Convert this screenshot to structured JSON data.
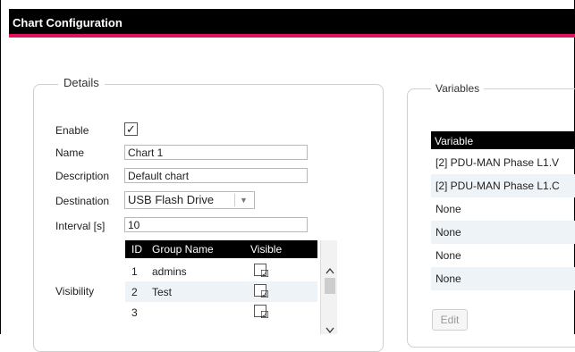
{
  "window": {
    "title": "Chart Configuration"
  },
  "details": {
    "legend": "Details",
    "enable": {
      "label": "Enable",
      "checked": true,
      "mark": "✓"
    },
    "name": {
      "label": "Name",
      "value": "Chart 1"
    },
    "description": {
      "label": "Description",
      "value": "Default chart"
    },
    "destination": {
      "label": "Destination",
      "value": "USB Flash Drive"
    },
    "interval": {
      "label": "Interval [s]",
      "value": "10"
    },
    "visibility": {
      "label": "Visibility",
      "columns": [
        "ID",
        "Group Name",
        "Visible"
      ],
      "rows": [
        {
          "id": "1",
          "group": "admins",
          "visible": true
        },
        {
          "id": "2",
          "group": "Test",
          "visible": true
        },
        {
          "id": "3",
          "group": "",
          "visible": true
        }
      ],
      "check_mark": "☑"
    }
  },
  "variables": {
    "legend": "Variables",
    "column": "Variable",
    "rows": [
      "[2] PDU-MAN Phase L1.V",
      "[2] PDU-MAN Phase L1.C",
      "None",
      "None",
      "None",
      "None"
    ],
    "edit_label": "Edit"
  },
  "colors": {
    "titlebar": "#000000",
    "accent": "#e0115f",
    "alt_row": "#eef3f8"
  }
}
